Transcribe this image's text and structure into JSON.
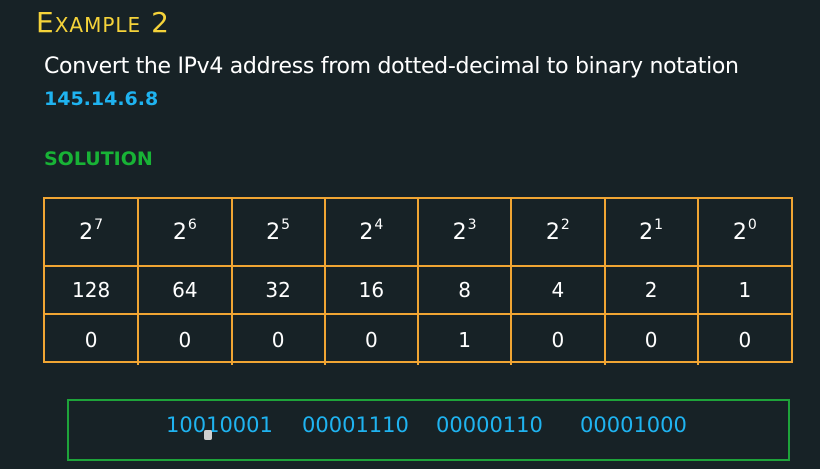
{
  "title": "Example 2",
  "question": "Convert the IPv4 address from dotted-decimal to binary notation",
  "address": "145.14.6.8",
  "solution_label": "SOLUTION",
  "table": {
    "powers": [
      {
        "base": "2",
        "exp": "7"
      },
      {
        "base": "2",
        "exp": "6"
      },
      {
        "base": "2",
        "exp": "5"
      },
      {
        "base": "2",
        "exp": "4"
      },
      {
        "base": "2",
        "exp": "3"
      },
      {
        "base": "2",
        "exp": "2"
      },
      {
        "base": "2",
        "exp": "1"
      },
      {
        "base": "2",
        "exp": "0"
      }
    ],
    "values": [
      "128",
      "64",
      "32",
      "16",
      "8",
      "4",
      "2",
      "1"
    ],
    "bits": [
      "0",
      "0",
      "0",
      "0",
      "1",
      "0",
      "0",
      "0"
    ]
  },
  "result": {
    "octets": [
      "10010001",
      "00001110",
      "00000110",
      "00001000"
    ]
  },
  "colors": {
    "background": "#172226",
    "title": "#f5d33a",
    "address": "#1fb3f0",
    "solution": "#18b336",
    "table_border": "#f0a533",
    "result_border": "#1ea33a"
  }
}
